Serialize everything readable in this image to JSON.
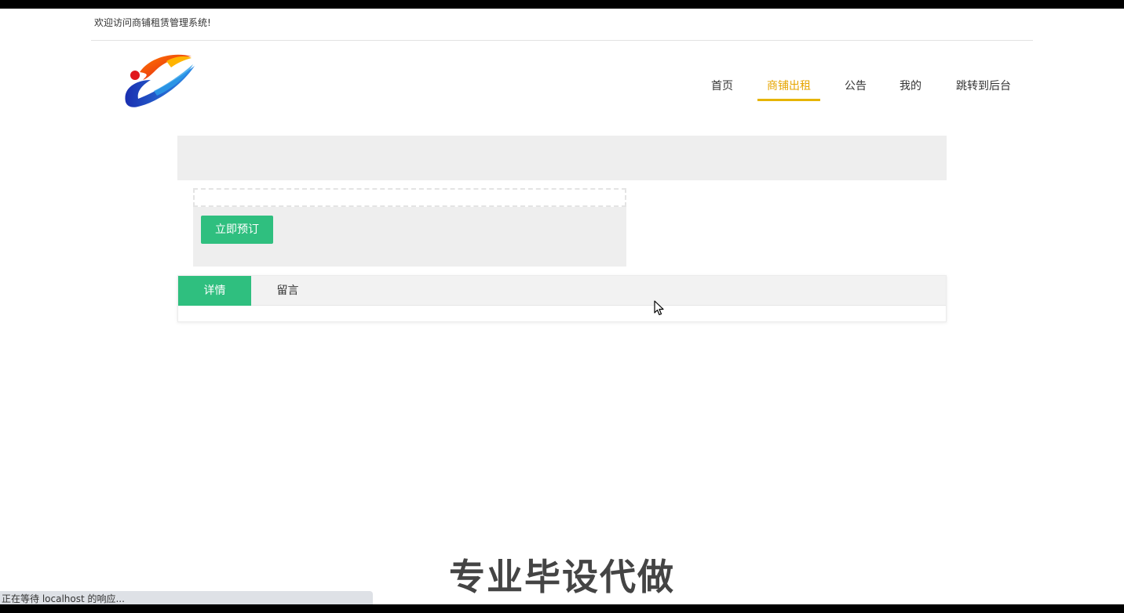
{
  "header": {
    "welcome_text": "欢迎访问商铺租赁管理系统!"
  },
  "nav": {
    "items": [
      {
        "label": "首页"
      },
      {
        "label": "商铺出租"
      },
      {
        "label": "公告"
      },
      {
        "label": "我的"
      },
      {
        "label": "跳转到后台"
      }
    ],
    "active_index": 1,
    "active_color": "#e6a500"
  },
  "detail": {
    "book_button": "立即预订"
  },
  "tabs": {
    "items": [
      {
        "label": "详情"
      },
      {
        "label": "留言"
      }
    ],
    "active_index": 0,
    "active_color": "#2fbf7f"
  },
  "overlay": {
    "watermark_text": "专业毕设代做"
  },
  "browser_status": {
    "text": "正在等待 localhost 的响应..."
  },
  "icons": {
    "logo": "logo-icon",
    "cursor": "mouse-pointer-icon"
  }
}
